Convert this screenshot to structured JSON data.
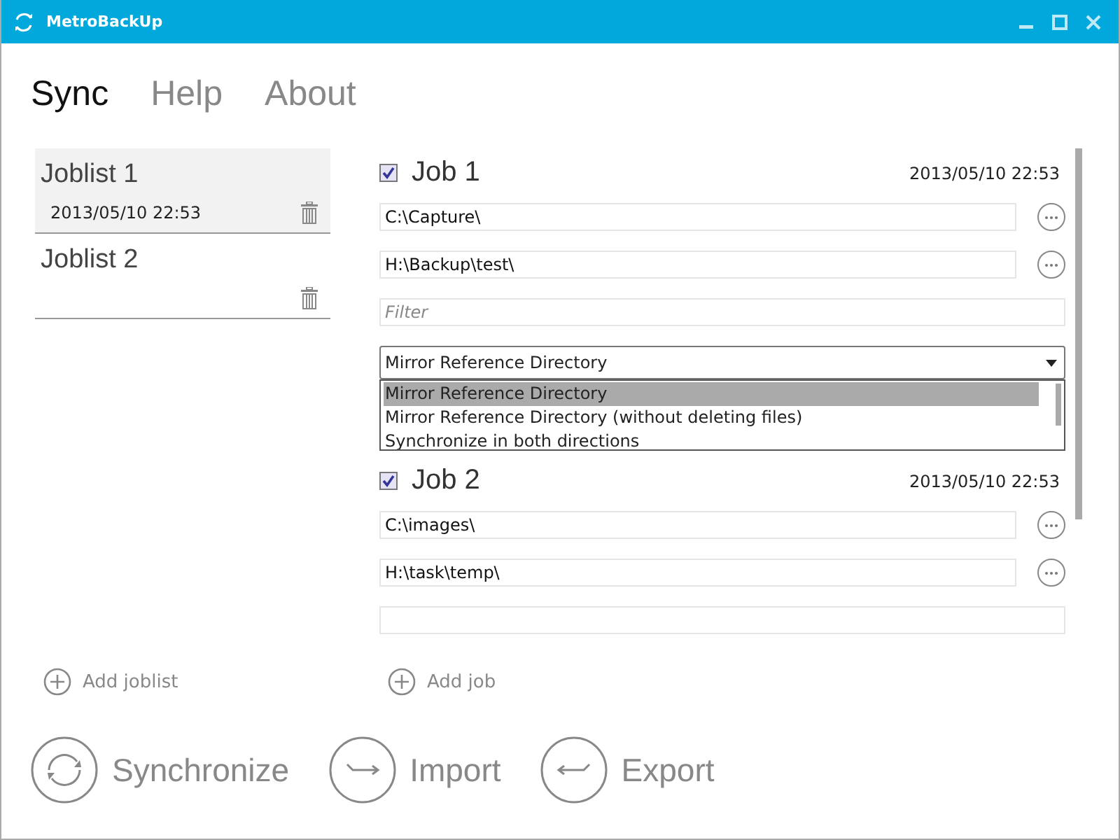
{
  "window": {
    "title": "MetroBackUp"
  },
  "tabs": [
    {
      "label": "Sync",
      "selected": true
    },
    {
      "label": "Help",
      "selected": false
    },
    {
      "label": "About",
      "selected": false
    }
  ],
  "joblists": [
    {
      "name": "Joblist 1",
      "date": "2013/05/10 22:53",
      "selected": true
    },
    {
      "name": "Joblist 2",
      "selected": false
    }
  ],
  "jobs": [
    {
      "name": "Job 1",
      "checked": true,
      "date": "2013/05/10 22:53",
      "source": "C:\\Capture\\",
      "destination": "H:\\Backup\\test\\",
      "filter_placeholder": "Filter",
      "mode": "Mirror Reference Directory",
      "dropdown": {
        "expanded": true,
        "options": [
          {
            "label": "Mirror Reference Directory",
            "selected": true
          },
          {
            "label": "Mirror Reference Directory (without deleting files)",
            "selected": false
          },
          {
            "label": "Synchronize in both directions",
            "selected": false
          }
        ]
      }
    },
    {
      "name": "Job 2",
      "checked": true,
      "date": "2013/05/10 22:53",
      "source": "C:\\images\\",
      "destination": "H:\\task\\temp\\"
    }
  ],
  "add_joblist": "Add joblist",
  "add_job": "Add job",
  "actions": [
    {
      "kind": "sync",
      "label": "Synchronize"
    },
    {
      "kind": "import",
      "label": "Import"
    },
    {
      "kind": "export",
      "label": "Export"
    }
  ]
}
